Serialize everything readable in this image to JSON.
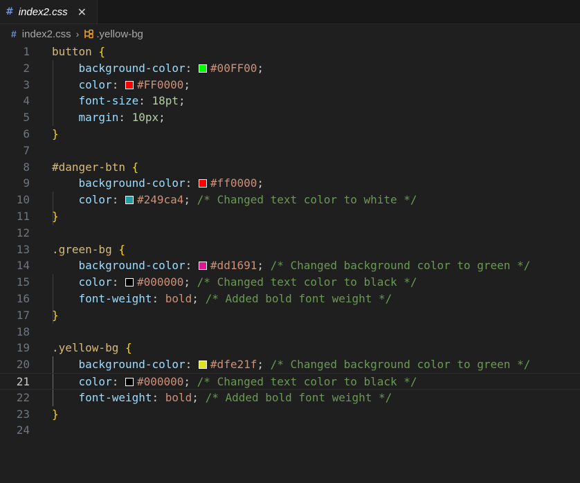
{
  "tab": {
    "icon": "css-hash-icon",
    "title": "index2.css",
    "close": "✕"
  },
  "breadcrumb": {
    "icon": "css-hash-icon",
    "file": "index2.css",
    "separator": "›",
    "symbol_icon": "css-rule-icon",
    "rule": ".yellow-bg"
  },
  "editor": {
    "active_line": 21,
    "lines": [
      {
        "n": "1",
        "tokens": [
          {
            "t": "button",
            "c": "sel"
          },
          {
            "t": " {",
            "c": "brace"
          }
        ]
      },
      {
        "n": "2",
        "tokens": [
          {
            "t": "    "
          },
          {
            "t": "background-color",
            "c": "prop"
          },
          {
            "t": ": "
          },
          {
            "swatch": "#00FF00"
          },
          {
            "t": "#00FF00",
            "c": "val"
          },
          {
            "t": ";"
          }
        ]
      },
      {
        "n": "3",
        "tokens": [
          {
            "t": "    "
          },
          {
            "t": "color",
            "c": "prop"
          },
          {
            "t": ": "
          },
          {
            "swatch": "#FF0000"
          },
          {
            "t": "#FF0000",
            "c": "val"
          },
          {
            "t": ";"
          }
        ]
      },
      {
        "n": "4",
        "tokens": [
          {
            "t": "    "
          },
          {
            "t": "font-size",
            "c": "prop"
          },
          {
            "t": ": "
          },
          {
            "t": "18pt",
            "c": "num"
          },
          {
            "t": ";"
          }
        ]
      },
      {
        "n": "5",
        "tokens": [
          {
            "t": "    "
          },
          {
            "t": "margin",
            "c": "prop"
          },
          {
            "t": ": "
          },
          {
            "t": "10px",
            "c": "num"
          },
          {
            "t": ";"
          }
        ]
      },
      {
        "n": "6",
        "tokens": [
          {
            "t": "}",
            "c": "brace"
          }
        ]
      },
      {
        "n": "7",
        "tokens": []
      },
      {
        "n": "8",
        "tokens": [
          {
            "t": "#danger-btn",
            "c": "sel"
          },
          {
            "t": " {",
            "c": "brace"
          }
        ]
      },
      {
        "n": "9",
        "tokens": [
          {
            "t": "    "
          },
          {
            "t": "background-color",
            "c": "prop"
          },
          {
            "t": ": "
          },
          {
            "swatch": "#ff0000"
          },
          {
            "t": "#ff0000",
            "c": "val"
          },
          {
            "t": ";"
          }
        ]
      },
      {
        "n": "10",
        "tokens": [
          {
            "t": "    "
          },
          {
            "t": "color",
            "c": "prop"
          },
          {
            "t": ": "
          },
          {
            "swatch": "#249ca4"
          },
          {
            "t": "#249ca4",
            "c": "val"
          },
          {
            "t": "; "
          },
          {
            "t": "/* Changed text color to white */",
            "c": "cmt"
          }
        ]
      },
      {
        "n": "11",
        "tokens": [
          {
            "t": "}",
            "c": "brace"
          }
        ]
      },
      {
        "n": "12",
        "tokens": []
      },
      {
        "n": "13",
        "tokens": [
          {
            "t": ".green-bg",
            "c": "sel"
          },
          {
            "t": " {",
            "c": "brace"
          }
        ]
      },
      {
        "n": "14",
        "tokens": [
          {
            "t": "    "
          },
          {
            "t": "background-color",
            "c": "prop"
          },
          {
            "t": ": "
          },
          {
            "swatch": "#dd1691"
          },
          {
            "t": "#dd1691",
            "c": "val"
          },
          {
            "t": "; "
          },
          {
            "t": "/* Changed background color to green */",
            "c": "cmt"
          }
        ]
      },
      {
        "n": "15",
        "tokens": [
          {
            "t": "    "
          },
          {
            "t": "color",
            "c": "prop"
          },
          {
            "t": ": "
          },
          {
            "swatch": "#000000"
          },
          {
            "t": "#000000",
            "c": "val"
          },
          {
            "t": "; "
          },
          {
            "t": "/* Changed text color to black */",
            "c": "cmt"
          }
        ]
      },
      {
        "n": "16",
        "tokens": [
          {
            "t": "    "
          },
          {
            "t": "font-weight",
            "c": "prop"
          },
          {
            "t": ": "
          },
          {
            "t": "bold",
            "c": "val"
          },
          {
            "t": "; "
          },
          {
            "t": "/* Added bold font weight */",
            "c": "cmt"
          }
        ]
      },
      {
        "n": "17",
        "tokens": [
          {
            "t": "}",
            "c": "brace"
          }
        ]
      },
      {
        "n": "18",
        "tokens": []
      },
      {
        "n": "19",
        "tokens": [
          {
            "t": ".yellow-bg",
            "c": "sel"
          },
          {
            "t": " {",
            "c": "brace"
          }
        ]
      },
      {
        "n": "20",
        "tokens": [
          {
            "t": "    "
          },
          {
            "t": "background-color",
            "c": "prop"
          },
          {
            "t": ": "
          },
          {
            "swatch": "#dfe21f"
          },
          {
            "t": "#dfe21f",
            "c": "val"
          },
          {
            "t": "; "
          },
          {
            "t": "/* Changed background color to green */",
            "c": "cmt"
          }
        ]
      },
      {
        "n": "21",
        "tokens": [
          {
            "t": "    "
          },
          {
            "t": "color",
            "c": "prop"
          },
          {
            "t": ": "
          },
          {
            "swatch": "#000000"
          },
          {
            "t": "#000000",
            "c": "val"
          },
          {
            "t": "; "
          },
          {
            "t": "/* Changed text color to black */",
            "c": "cmt"
          }
        ]
      },
      {
        "n": "22",
        "tokens": [
          {
            "t": "    "
          },
          {
            "t": "font-weight",
            "c": "prop"
          },
          {
            "t": ": "
          },
          {
            "t": "bold",
            "c": "val"
          },
          {
            "t": "; "
          },
          {
            "t": "/* Added bold font weight */",
            "c": "cmt"
          }
        ]
      },
      {
        "n": "23",
        "tokens": [
          {
            "t": "}",
            "c": "brace"
          }
        ]
      },
      {
        "n": "24",
        "tokens": []
      }
    ]
  }
}
